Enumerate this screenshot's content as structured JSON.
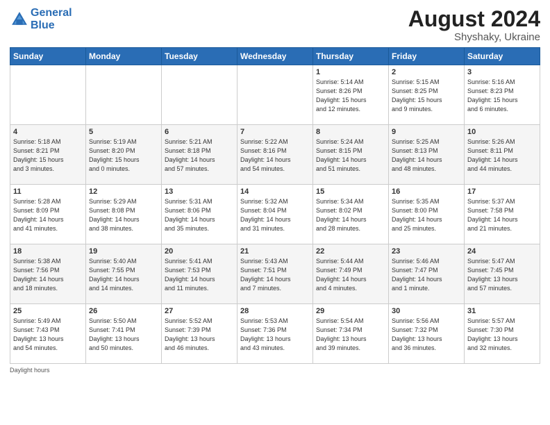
{
  "header": {
    "logo_line1": "General",
    "logo_line2": "Blue",
    "month_year": "August 2024",
    "location": "Shyshaky, Ukraine"
  },
  "weekdays": [
    "Sunday",
    "Monday",
    "Tuesday",
    "Wednesday",
    "Thursday",
    "Friday",
    "Saturday"
  ],
  "weeks": [
    [
      {
        "day": "",
        "info": ""
      },
      {
        "day": "",
        "info": ""
      },
      {
        "day": "",
        "info": ""
      },
      {
        "day": "",
        "info": ""
      },
      {
        "day": "1",
        "info": "Sunrise: 5:14 AM\nSunset: 8:26 PM\nDaylight: 15 hours\nand 12 minutes."
      },
      {
        "day": "2",
        "info": "Sunrise: 5:15 AM\nSunset: 8:25 PM\nDaylight: 15 hours\nand 9 minutes."
      },
      {
        "day": "3",
        "info": "Sunrise: 5:16 AM\nSunset: 8:23 PM\nDaylight: 15 hours\nand 6 minutes."
      }
    ],
    [
      {
        "day": "4",
        "info": "Sunrise: 5:18 AM\nSunset: 8:21 PM\nDaylight: 15 hours\nand 3 minutes."
      },
      {
        "day": "5",
        "info": "Sunrise: 5:19 AM\nSunset: 8:20 PM\nDaylight: 15 hours\nand 0 minutes."
      },
      {
        "day": "6",
        "info": "Sunrise: 5:21 AM\nSunset: 8:18 PM\nDaylight: 14 hours\nand 57 minutes."
      },
      {
        "day": "7",
        "info": "Sunrise: 5:22 AM\nSunset: 8:16 PM\nDaylight: 14 hours\nand 54 minutes."
      },
      {
        "day": "8",
        "info": "Sunrise: 5:24 AM\nSunset: 8:15 PM\nDaylight: 14 hours\nand 51 minutes."
      },
      {
        "day": "9",
        "info": "Sunrise: 5:25 AM\nSunset: 8:13 PM\nDaylight: 14 hours\nand 48 minutes."
      },
      {
        "day": "10",
        "info": "Sunrise: 5:26 AM\nSunset: 8:11 PM\nDaylight: 14 hours\nand 44 minutes."
      }
    ],
    [
      {
        "day": "11",
        "info": "Sunrise: 5:28 AM\nSunset: 8:09 PM\nDaylight: 14 hours\nand 41 minutes."
      },
      {
        "day": "12",
        "info": "Sunrise: 5:29 AM\nSunset: 8:08 PM\nDaylight: 14 hours\nand 38 minutes."
      },
      {
        "day": "13",
        "info": "Sunrise: 5:31 AM\nSunset: 8:06 PM\nDaylight: 14 hours\nand 35 minutes."
      },
      {
        "day": "14",
        "info": "Sunrise: 5:32 AM\nSunset: 8:04 PM\nDaylight: 14 hours\nand 31 minutes."
      },
      {
        "day": "15",
        "info": "Sunrise: 5:34 AM\nSunset: 8:02 PM\nDaylight: 14 hours\nand 28 minutes."
      },
      {
        "day": "16",
        "info": "Sunrise: 5:35 AM\nSunset: 8:00 PM\nDaylight: 14 hours\nand 25 minutes."
      },
      {
        "day": "17",
        "info": "Sunrise: 5:37 AM\nSunset: 7:58 PM\nDaylight: 14 hours\nand 21 minutes."
      }
    ],
    [
      {
        "day": "18",
        "info": "Sunrise: 5:38 AM\nSunset: 7:56 PM\nDaylight: 14 hours\nand 18 minutes."
      },
      {
        "day": "19",
        "info": "Sunrise: 5:40 AM\nSunset: 7:55 PM\nDaylight: 14 hours\nand 14 minutes."
      },
      {
        "day": "20",
        "info": "Sunrise: 5:41 AM\nSunset: 7:53 PM\nDaylight: 14 hours\nand 11 minutes."
      },
      {
        "day": "21",
        "info": "Sunrise: 5:43 AM\nSunset: 7:51 PM\nDaylight: 14 hours\nand 7 minutes."
      },
      {
        "day": "22",
        "info": "Sunrise: 5:44 AM\nSunset: 7:49 PM\nDaylight: 14 hours\nand 4 minutes."
      },
      {
        "day": "23",
        "info": "Sunrise: 5:46 AM\nSunset: 7:47 PM\nDaylight: 14 hours\nand 1 minute."
      },
      {
        "day": "24",
        "info": "Sunrise: 5:47 AM\nSunset: 7:45 PM\nDaylight: 13 hours\nand 57 minutes."
      }
    ],
    [
      {
        "day": "25",
        "info": "Sunrise: 5:49 AM\nSunset: 7:43 PM\nDaylight: 13 hours\nand 54 minutes."
      },
      {
        "day": "26",
        "info": "Sunrise: 5:50 AM\nSunset: 7:41 PM\nDaylight: 13 hours\nand 50 minutes."
      },
      {
        "day": "27",
        "info": "Sunrise: 5:52 AM\nSunset: 7:39 PM\nDaylight: 13 hours\nand 46 minutes."
      },
      {
        "day": "28",
        "info": "Sunrise: 5:53 AM\nSunset: 7:36 PM\nDaylight: 13 hours\nand 43 minutes."
      },
      {
        "day": "29",
        "info": "Sunrise: 5:54 AM\nSunset: 7:34 PM\nDaylight: 13 hours\nand 39 minutes."
      },
      {
        "day": "30",
        "info": "Sunrise: 5:56 AM\nSunset: 7:32 PM\nDaylight: 13 hours\nand 36 minutes."
      },
      {
        "day": "31",
        "info": "Sunrise: 5:57 AM\nSunset: 7:30 PM\nDaylight: 13 hours\nand 32 minutes."
      }
    ]
  ],
  "footer": {
    "text": "Daylight hours"
  }
}
